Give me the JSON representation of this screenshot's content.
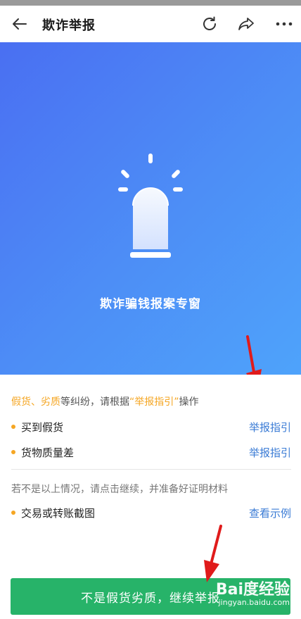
{
  "header": {
    "title": "欺诈举报"
  },
  "hero": {
    "title": "欺诈骗钱报案专窗"
  },
  "content": {
    "intro": {
      "highlight1": "假货、劣质",
      "text1": "等纠纷，请根据",
      "highlight2": "“举报指引”",
      "text2": "操作"
    },
    "items": [
      {
        "label": "买到假货",
        "link": "举报指引"
      },
      {
        "label": "货物质量差",
        "link": "举报指引"
      }
    ],
    "hint": "若不是以上情况，请点击继续，并准备好证明材料",
    "evidence": {
      "label": "交易或转账截图",
      "link": "查看示例"
    }
  },
  "continue_button": {
    "label": "不是假货劣质，继续举报"
  },
  "watermark": {
    "brand": "Bai度经验",
    "url": "jingyan.baidu.com"
  },
  "colors": {
    "hero_start": "#4a6ff2",
    "hero_end": "#4ea3fb",
    "accent_orange": "#f5a623",
    "link_blue": "#3a7bd5",
    "button_green": "#27b369"
  }
}
